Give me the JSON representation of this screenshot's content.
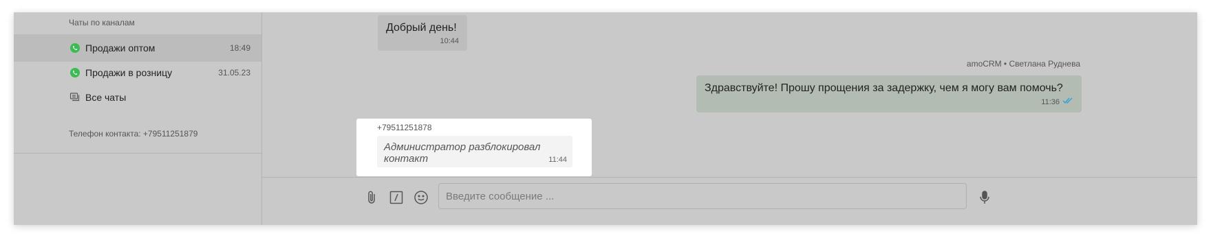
{
  "sidebar": {
    "heading": "Чаты по каналам",
    "channels": [
      {
        "label": "Продажи оптом",
        "time": "18:49",
        "icon": "whatsapp-icon"
      },
      {
        "label": "Продажи в розницу",
        "time": "31.05.23",
        "icon": "whatsapp-icon"
      },
      {
        "label": "Все чаты",
        "time": "",
        "icon": "chats-icon"
      }
    ],
    "contact_phone": "Телефон контакта: +79511251879"
  },
  "messages": {
    "incoming": {
      "text": "Добрый день!",
      "time": "10:44"
    },
    "outgoing": {
      "author": "amoCRM • Светлана Руднева",
      "text": "Здравствуйте! Прошу прощения за задержку, чем я могу вам помочь?",
      "time": "11:36",
      "status_icon": "double-check-icon"
    },
    "system": {
      "sender": "+79511251878",
      "text": "Администратор разблокировал контакт",
      "time": "11:44"
    }
  },
  "composer": {
    "placeholder": "Введите сообщение ...",
    "tools": [
      "paperclip-icon",
      "slash-command-icon",
      "emoji-icon"
    ],
    "mic_icon": "microphone-icon"
  },
  "colors": {
    "overlay": "#c9c9c9",
    "whatsapp": "#3cba54",
    "read_check": "#2aa3d8"
  }
}
